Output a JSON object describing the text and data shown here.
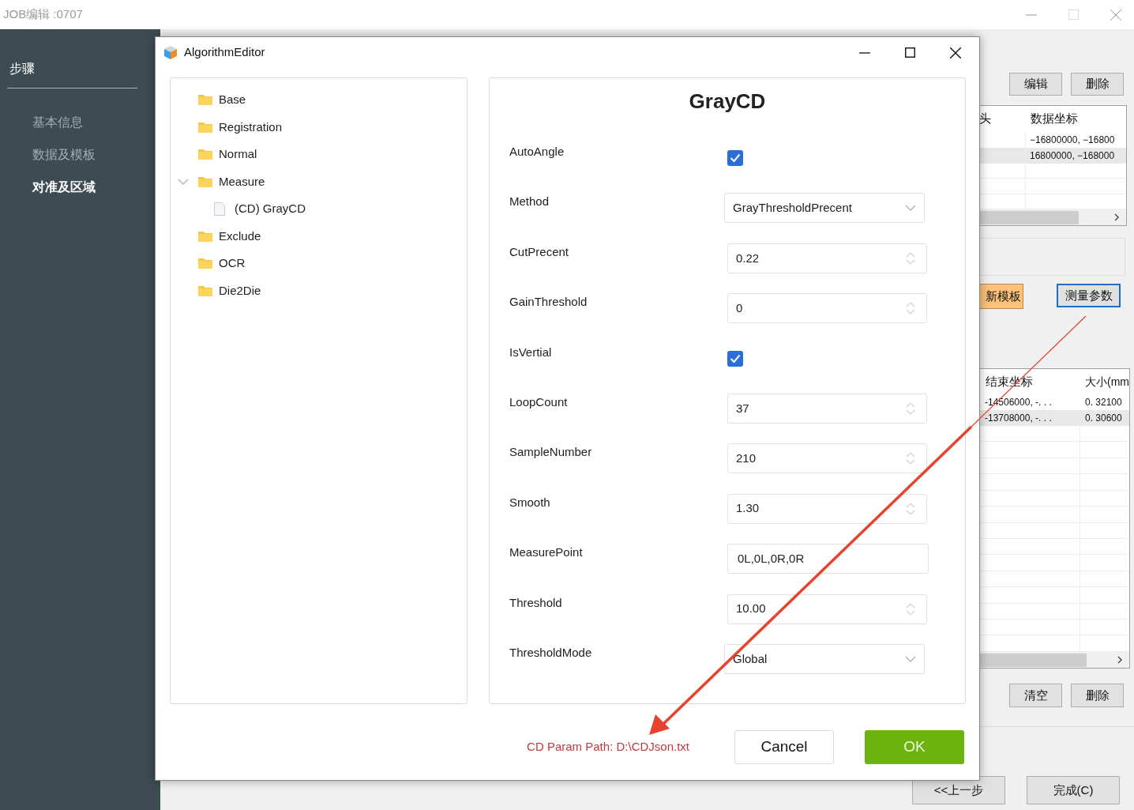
{
  "window": {
    "title": "JOB编辑 :0707"
  },
  "sidebar": {
    "heading": "步骤",
    "items": [
      {
        "label": "基本信息",
        "selected": false
      },
      {
        "label": "数据及模板",
        "selected": false
      },
      {
        "label": "对准及区域",
        "selected": true
      }
    ]
  },
  "right_panel": {
    "top_buttons": [
      "编辑",
      "删除"
    ],
    "table_1": {
      "columns": [
        "头",
        "数据坐标"
      ],
      "rows": [
        {
          "coordinate": "−16800000, −16800",
          "selected": false
        },
        {
          "coordinate": "16800000, −168000",
          "selected": true
        }
      ]
    },
    "template_button": "新模板",
    "measure_button": "测量参数",
    "table_2": {
      "columns": [
        "结束坐标",
        "大小(mm"
      ],
      "rows": [
        {
          "end": "-14506000, -. . .",
          "size": "0. 32100",
          "selected": false
        },
        {
          "end": "-13708000, -. . .",
          "size": "0. 30600",
          "selected": true
        }
      ]
    },
    "bottom_buttons": [
      "清空",
      "删除"
    ],
    "nav_buttons": [
      "<<上一步",
      "完成(C)"
    ]
  },
  "dialog": {
    "title": "AlgorithmEditor",
    "tree": [
      {
        "label": "Base",
        "kind": "folder",
        "expanded": false
      },
      {
        "label": "Registration",
        "kind": "folder",
        "expanded": false
      },
      {
        "label": "Normal",
        "kind": "folder",
        "expanded": false
      },
      {
        "label": "Measure",
        "kind": "folder",
        "expanded": true,
        "children": [
          {
            "label": "(CD) GrayCD",
            "kind": "file"
          }
        ]
      },
      {
        "label": "Exclude",
        "kind": "folder",
        "expanded": false
      },
      {
        "label": "OCR",
        "kind": "folder",
        "expanded": false
      },
      {
        "label": "Die2Die",
        "kind": "folder",
        "expanded": false
      }
    ],
    "heading": "GrayCD",
    "params": [
      {
        "label": "AutoAngle",
        "kind": "checkbox",
        "checked": true
      },
      {
        "label": "Method",
        "kind": "select",
        "value": "GrayThresholdPrecent"
      },
      {
        "label": "CutPrecent",
        "kind": "number",
        "value": "0.22"
      },
      {
        "label": "GainThreshold",
        "kind": "number",
        "value": "0"
      },
      {
        "label": "IsVertial",
        "kind": "checkbox",
        "checked": true
      },
      {
        "label": "LoopCount",
        "kind": "number",
        "value": "37"
      },
      {
        "label": "SampleNumber",
        "kind": "number",
        "value": "210"
      },
      {
        "label": "Smooth",
        "kind": "number",
        "value": "1.30"
      },
      {
        "label": "MeasurePoint",
        "kind": "text",
        "value": "0L,0L,0R,0R"
      },
      {
        "label": "Threshold",
        "kind": "number",
        "value": "10.00"
      },
      {
        "label": "ThresholdMode",
        "kind": "select",
        "value": "Global"
      }
    ],
    "path_note": "CD Param Path: D:\\CDJson.txt",
    "buttons": [
      "Cancel",
      "OK"
    ]
  }
}
